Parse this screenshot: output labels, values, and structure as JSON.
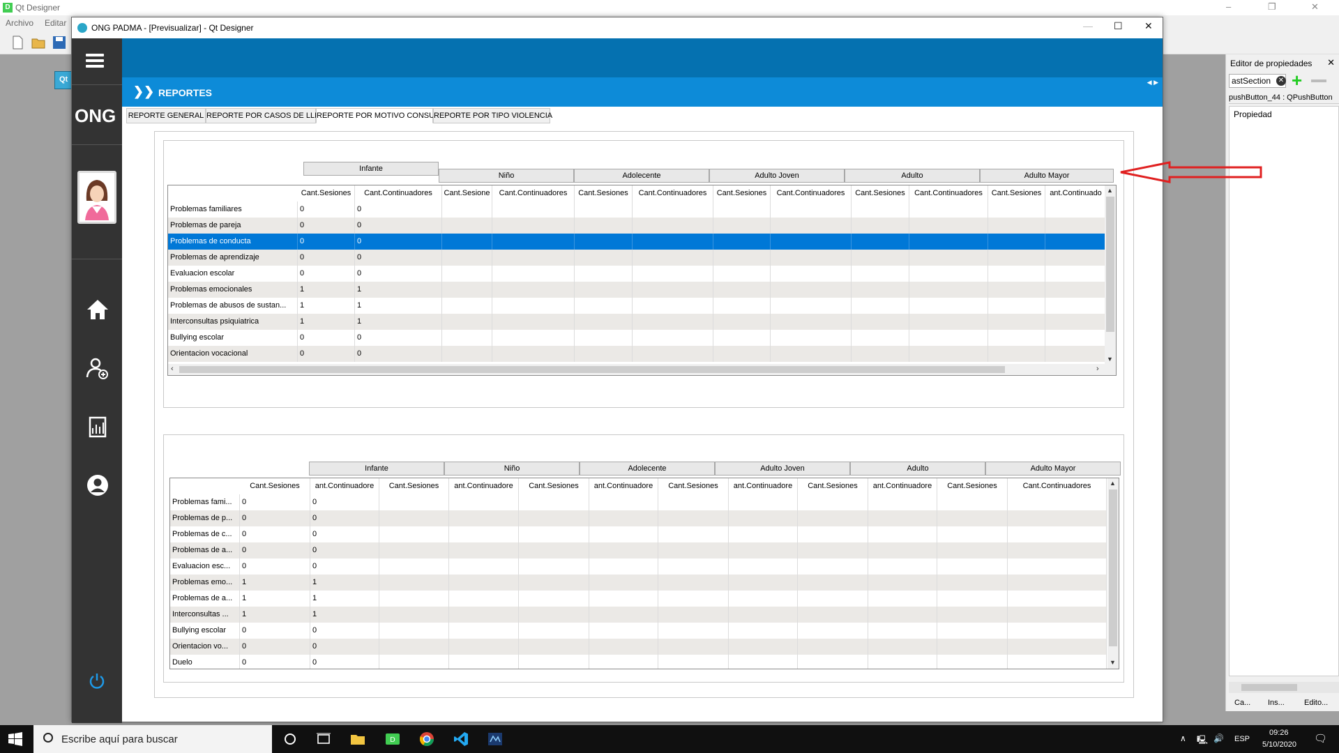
{
  "designer": {
    "title": "Qt Designer",
    "menu": [
      "Archivo",
      "Editar"
    ],
    "qt_badge": "Qt"
  },
  "property_editor": {
    "title": "Editor de propiedades",
    "filter_value": "astSection",
    "object_label": "pushButton_44 : QPushButton",
    "column_label": "Propiedad",
    "tabs": [
      "Ca...",
      "Ins...",
      "Edito..."
    ]
  },
  "window": {
    "title": "ONG PADMA - [Previsualizar] - Qt Designer",
    "brand": "ONG",
    "section_title": "REPORTES"
  },
  "tabs": [
    {
      "label": "REPORTE GENERAL",
      "active": false
    },
    {
      "label": "REPORTE POR CASOS DE LLEGADA",
      "active": false
    },
    {
      "label": "REPORTE POR MOTIVO CONSULTA",
      "active": true
    },
    {
      "label": "REPORTE POR TIPO VIOLENCIA",
      "active": false
    }
  ],
  "table1": {
    "groups": [
      "Infante",
      "Niño",
      "Adolecente",
      "Adulto Joven",
      "Adulto",
      "Adulto Mayor"
    ],
    "columns": [
      "Cant.Sesiones",
      "Cant.Continuadores",
      "Cant.Sesione",
      "Cant.Continuadores",
      "Cant.Sesiones",
      "Cant.Continuadores",
      "Cant.Sesiones",
      "Cant.Continuadores",
      "Cant.Sesiones",
      "Cant.Continuadores",
      "Cant.Sesiones",
      "ant.Continuado"
    ],
    "rows": [
      {
        "label": "Problemas familiares",
        "values": [
          "0",
          "0"
        ]
      },
      {
        "label": "Problemas de pareja",
        "values": [
          "0",
          "0"
        ]
      },
      {
        "label": "Problemas de conducta",
        "values": [
          "0",
          "0"
        ]
      },
      {
        "label": "Problemas de aprendizaje",
        "values": [
          "0",
          "0"
        ]
      },
      {
        "label": "Evaluacion escolar",
        "values": [
          "0",
          "0"
        ]
      },
      {
        "label": "Problemas emocionales",
        "values": [
          "1",
          "1"
        ]
      },
      {
        "label": "Problemas de abusos de sustan...",
        "values": [
          "1",
          "1"
        ]
      },
      {
        "label": "Interconsultas psiquiatrica",
        "values": [
          "1",
          "1"
        ]
      },
      {
        "label": "Bullying escolar",
        "values": [
          "0",
          "0"
        ]
      },
      {
        "label": "Orientacion vocacional",
        "values": [
          "0",
          "0"
        ]
      }
    ],
    "selected_row": 2
  },
  "table2": {
    "groups": [
      "Infante",
      "Niño",
      "Adolecente",
      "Adulto Joven",
      "Adulto",
      "Adulto Mayor"
    ],
    "columns": [
      "Cant.Sesiones",
      "ant.Continuadore",
      "Cant.Sesiones",
      "ant.Continuadore",
      "Cant.Sesiones",
      "ant.Continuadore",
      "Cant.Sesiones",
      "ant.Continuadore",
      "Cant.Sesiones",
      "ant.Continuadore",
      "Cant.Sesiones",
      "Cant.Continuadores"
    ],
    "rows": [
      {
        "label": "Problemas fami...",
        "values": [
          "0",
          "0"
        ]
      },
      {
        "label": "Problemas de p...",
        "values": [
          "0",
          "0"
        ]
      },
      {
        "label": "Problemas de c...",
        "values": [
          "0",
          "0"
        ]
      },
      {
        "label": "Problemas de a...",
        "values": [
          "0",
          "0"
        ]
      },
      {
        "label": "Evaluacion esc...",
        "values": [
          "0",
          "0"
        ]
      },
      {
        "label": "Problemas emo...",
        "values": [
          "1",
          "1"
        ]
      },
      {
        "label": "Problemas de a...",
        "values": [
          "1",
          "1"
        ]
      },
      {
        "label": "Interconsultas ...",
        "values": [
          "1",
          "1"
        ]
      },
      {
        "label": "Bullying escolar",
        "values": [
          "0",
          "0"
        ]
      },
      {
        "label": "Orientacion vo...",
        "values": [
          "0",
          "0"
        ]
      },
      {
        "label": "Duelo",
        "values": [
          "0",
          "0"
        ]
      }
    ]
  },
  "taskbar": {
    "search_placeholder": "Escribe aquí para buscar",
    "lang": "ESP",
    "time": "09:26",
    "date": "5/10/2020"
  },
  "colors": {
    "sidebar": "#333333",
    "header_dark": "#0571b0",
    "header_light": "#0d8bd8",
    "selection": "#0078d7",
    "annotation_arrow": "#e02020"
  }
}
